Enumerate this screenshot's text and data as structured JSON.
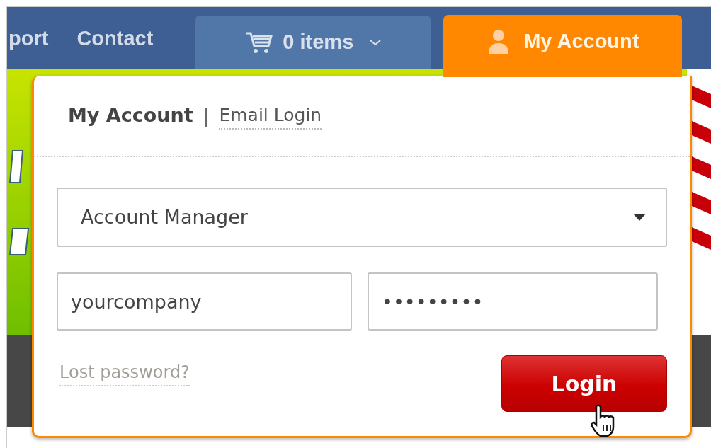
{
  "nav": {
    "links": [
      {
        "label": "port"
      },
      {
        "label": "Contact"
      }
    ],
    "cart": {
      "label": "0 items"
    },
    "account_tab": {
      "label": "My Account",
      "selected": true
    }
  },
  "login_panel": {
    "title": "My Account",
    "separator": "|",
    "alt_link": "Email Login",
    "account_type": {
      "value": "Account Manager"
    },
    "username": {
      "value": "yourcompany"
    },
    "password": {
      "value": "•••••••••"
    },
    "lost_password": "Lost password?",
    "submit": "Login"
  }
}
